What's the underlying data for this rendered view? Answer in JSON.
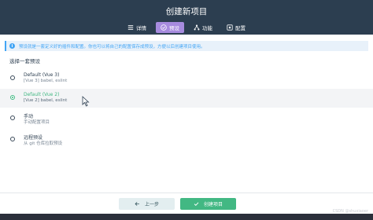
{
  "header": {
    "title": "创建新项目",
    "tabs": [
      {
        "label": "详情",
        "icon": "list-icon"
      },
      {
        "label": "预设",
        "icon": "check-circle-icon",
        "active": true
      },
      {
        "label": "功能",
        "icon": "tree-icon"
      },
      {
        "label": "配置",
        "icon": "settings-box-icon"
      }
    ]
  },
  "info": {
    "text": "预设就是一套定义好的插件和配置。你也可以将自己的配置保存成预设，方便以后创建项目使用。"
  },
  "section_title": "选择一套预设",
  "presets": [
    {
      "name": "Default (Vue 3)",
      "desc": "[Vue 3] babel, eslint",
      "selected": false
    },
    {
      "name": "Default (Vue 2)",
      "desc": "[Vue 2] babel, eslint",
      "selected": true
    },
    {
      "name": "手动",
      "desc": "手动配置项目",
      "selected": false
    },
    {
      "name": "远程预设",
      "desc": "从 git 仓库拉取预设",
      "selected": false
    }
  ],
  "footer": {
    "prev_label": "上一步",
    "create_label": "创建项目"
  },
  "watermark": "CSDN @shuxiaoer",
  "colors": {
    "header_bg": "#2c3e50",
    "accent_green": "#42b883",
    "tab_active": "#a78bde",
    "info_blue": "#42a5f5"
  }
}
